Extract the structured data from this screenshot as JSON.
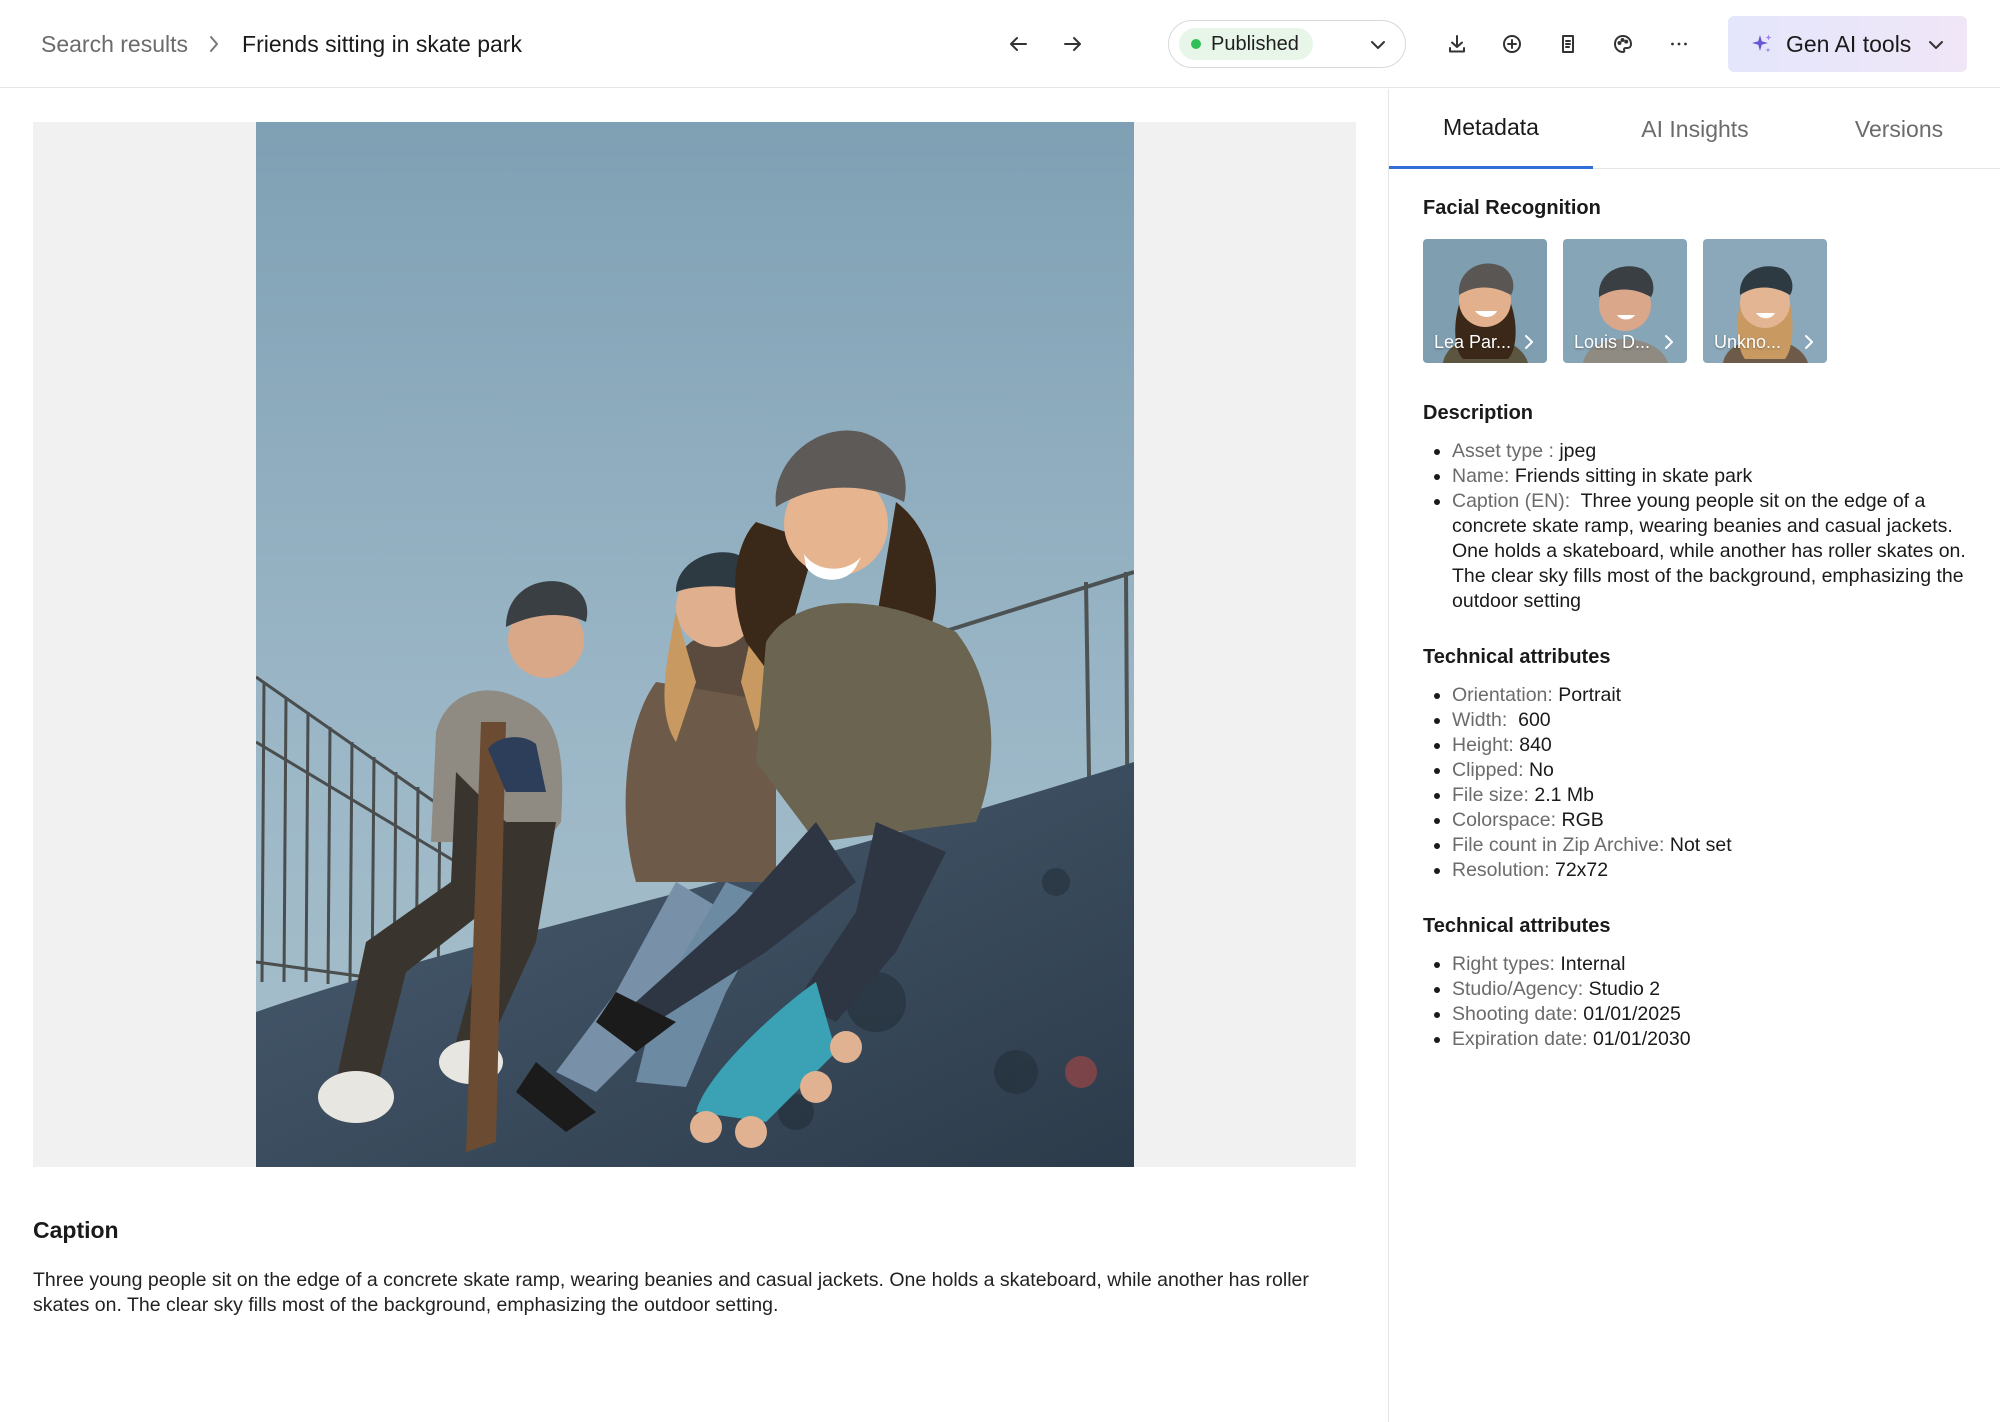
{
  "breadcrumb": {
    "parent": "Search results",
    "current": "Friends sitting in skate park"
  },
  "status": {
    "label": "Published",
    "color": "#2fbf57"
  },
  "gen_ai": {
    "label": "Gen AI tools"
  },
  "toolbar_icons": [
    "back-arrow-icon",
    "forward-arrow-icon",
    "download-icon",
    "add-circle-icon",
    "document-icon",
    "palette-icon",
    "more-icon"
  ],
  "caption": {
    "title": "Caption",
    "text": "Three young people sit on the edge of a concrete skate ramp, wearing beanies and casual jackets. One holds a skateboard, while another has roller skates on. The clear sky fills most of the background, emphasizing the outdoor setting."
  },
  "tabs": [
    {
      "label": "Metadata",
      "active": true
    },
    {
      "label": "AI Insights",
      "active": false
    },
    {
      "label": "Versions",
      "active": false
    }
  ],
  "facial_recognition": {
    "title": "Facial Recognition",
    "faces": [
      {
        "name": "Lea Par..."
      },
      {
        "name": "Louis D..."
      },
      {
        "name": "Unkno..."
      }
    ]
  },
  "description": {
    "title": "Description",
    "items": [
      {
        "key": "Asset type :",
        "value": "jpeg"
      },
      {
        "key": "Name:",
        "value": "Friends sitting in skate park"
      },
      {
        "key": "Caption (EN):",
        "value": "Three young people sit on the edge of a concrete skate ramp, wearing beanies and casual jackets. One holds a skateboard, while another has roller skates on. The clear sky fills most of the background, emphasizing the outdoor setting"
      }
    ]
  },
  "technical": {
    "title": "Technical attributes",
    "items": [
      {
        "key": "Orientation:",
        "value": "Portrait"
      },
      {
        "key": "Width:",
        "value": "600"
      },
      {
        "key": "Height:",
        "value": "840"
      },
      {
        "key": "Clipped:",
        "value": "No"
      },
      {
        "key": "File size:",
        "value": "2.1 Mb"
      },
      {
        "key": "Colorspace:",
        "value": "RGB"
      },
      {
        "key": "File count in Zip Archive:",
        "value": "Not set"
      },
      {
        "key": "Resolution:",
        "value": "72x72"
      }
    ]
  },
  "rights": {
    "title": "Technical attributes",
    "items": [
      {
        "key": "Right types:",
        "value": "Internal"
      },
      {
        "key": "Studio/Agency:",
        "value": "Studio 2"
      },
      {
        "key": "Shooting date:",
        "value": "01/01/2025"
      },
      {
        "key": "Expiration date:",
        "value": "01/01/2030"
      }
    ]
  }
}
